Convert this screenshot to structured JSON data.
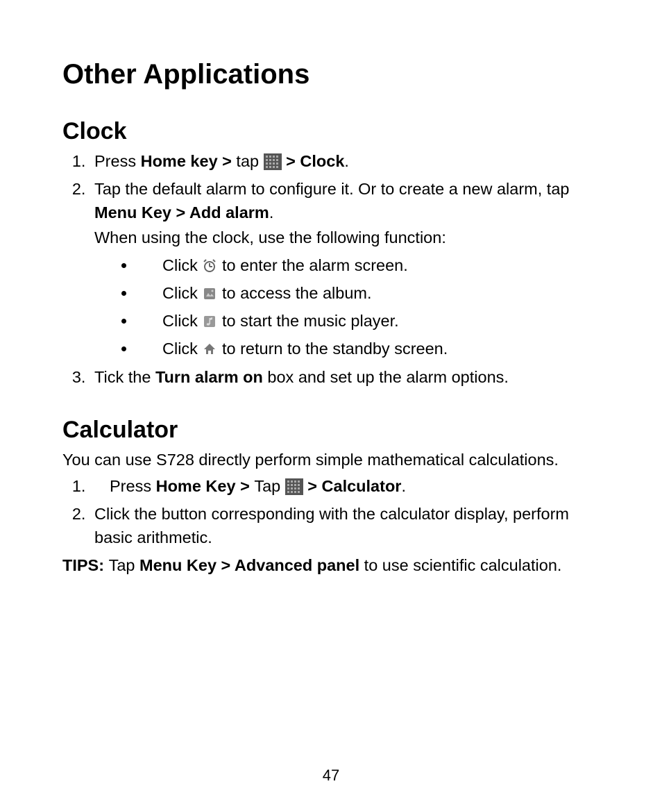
{
  "title": "Other Applications",
  "page_number": "47",
  "clock": {
    "heading": "Clock",
    "step1_a": "Press ",
    "step1_b": "Home key > ",
    "step1_c": "tap ",
    "step1_d": " > Clock",
    "step1_e": ".",
    "step2_a": "Tap the default alarm to configure it. Or to create a new alarm, tap ",
    "step2_b": "Menu Key > Add alarm",
    "step2_c": ".",
    "step2_when": "When using the clock, use the following function:",
    "b1_a": "Click ",
    "b1_b": " to enter the alarm screen.",
    "b2_a": "Click ",
    "b2_b": " to access the album.",
    "b3_a": "Click ",
    "b3_b": " to start the music player.",
    "b4_a": "Click ",
    "b4_b": " to return to the standby screen.",
    "step3_a": "Tick the ",
    "step3_b": "Turn alarm on",
    "step3_c": " box and set up the alarm options."
  },
  "calculator": {
    "heading": "Calculator",
    "intro": "You can use S728 directly perform simple mathematical calculations.",
    "step1_a": "Press ",
    "step1_b": "Home Key > ",
    "step1_c": "Tap ",
    "step1_d": " > Calculator",
    "step1_e": ".",
    "step2": " Click the button corresponding with the calculator display, perform basic arithmetic.",
    "tips_label": "TIPS: ",
    "tips_a": "Tap ",
    "tips_b": "Menu Key > Advanced panel",
    "tips_c": " to use scientific calculation."
  }
}
